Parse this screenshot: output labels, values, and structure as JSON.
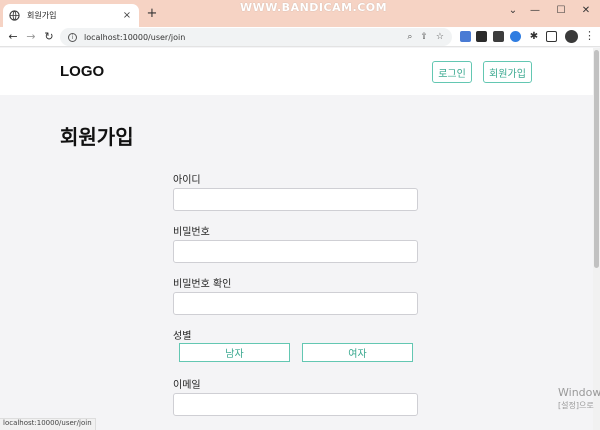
{
  "browser": {
    "tab_title": "회원가입",
    "tab_close": "×",
    "new_tab": "+",
    "watermark": "WWW.BANDICAM.COM",
    "url": "localhost:10000/user/join",
    "status_url": "localhost:10000/user/join"
  },
  "header": {
    "logo": "LOGO",
    "login_button": "로그인",
    "signup_button": "회원가입",
    "accent_color": "#39a88f"
  },
  "form": {
    "title": "회원가입",
    "id_label": "아이디",
    "id_value": "",
    "password_label": "비밀번호",
    "password_value": "",
    "password_confirm_label": "비밀번호 확인",
    "password_confirm_value": "",
    "gender_label": "성별",
    "gender_male": "남자",
    "gender_female": "여자",
    "email_label": "이메일",
    "email_value": ""
  },
  "os_overlay": {
    "activate_title": "Windows",
    "activate_sub": "[설정]으로"
  }
}
